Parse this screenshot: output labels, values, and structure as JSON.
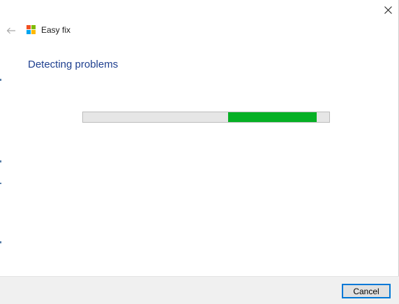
{
  "window": {
    "app_title": "Easy fix",
    "close_icon": "close-icon",
    "back_icon": "back-arrow-icon",
    "logo_icon": "windows-logo-icon"
  },
  "main": {
    "heading": "Detecting problems",
    "progress": {
      "indeterminate": true,
      "segment_start": 0.59,
      "segment_end": 0.95,
      "fill_color": "#06b025",
      "track_color": "#e6e6e6"
    }
  },
  "footer": {
    "cancel_label": "Cancel"
  },
  "colors": {
    "heading": "#1e3f8f",
    "focus_border": "#0078d7",
    "logo": [
      "#f25022",
      "#7fba00",
      "#00a4ef",
      "#ffb900"
    ]
  }
}
